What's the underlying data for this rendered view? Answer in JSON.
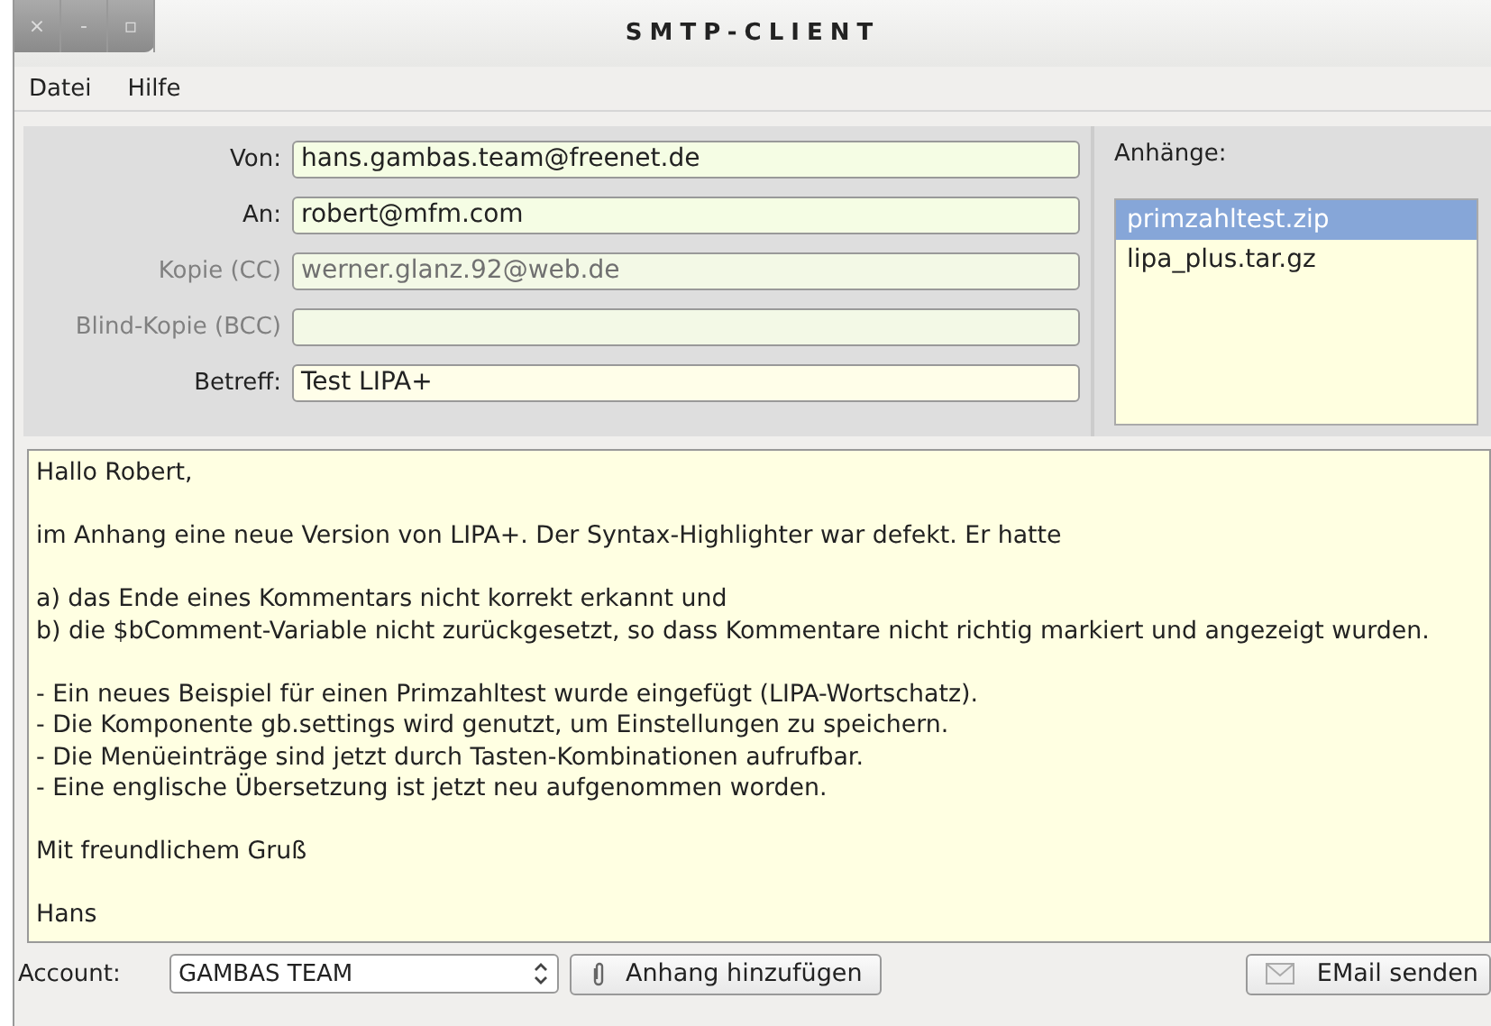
{
  "window": {
    "title": "SMTP-CLIENT",
    "controls": [
      "×",
      "-",
      "▫"
    ]
  },
  "menu": [
    "Datei",
    "Hilfe"
  ],
  "fields": [
    {
      "label": "Von:",
      "value": "hans.gambas.team@freenet.de",
      "disabled": false
    },
    {
      "label": "An:",
      "value": "robert@mfm.com",
      "disabled": false
    },
    {
      "label": "Kopie (CC)",
      "value": "werner.glanz.92@web.de",
      "disabled": true
    },
    {
      "label": "Blind-Kopie (BCC)",
      "disabled": true
    },
    {
      "label": "Betreff:",
      "value": "Test LIPA+",
      "disabled": false
    }
  ],
  "attachments": {
    "label": "Anhänge:",
    "items": [
      {
        "name": "primzahltest.zip",
        "selected": true
      },
      {
        "name": "lipa_plus.tar.gz",
        "selected": false
      }
    ]
  },
  "body": [
    [
      "Hallo Robert,"
    ],
    [
      "im Anhang eine neue Version von LIPA+. Der Syntax-Highlighter war defekt. Er hatte"
    ],
    [
      "a) das Ende eines Kommentars nicht korrekt erkannt und",
      "b) die $bComment-Variable nicht zurückgesetzt, so dass Kommentare nicht richtig markiert und angezeigt wurden."
    ],
    [
      "- Ein neues Beispiel für einen Primzahltest wurde eingefügt (LIPA-Wortschatz).",
      "- Die Komponente gb.settings wird genutzt, um Einstellungen zu speichern.",
      "- Die Menüeinträge sind jetzt durch Tasten-Kombinationen aufrufbar.",
      "- Eine englische Übersetzung ist jetzt neu aufgenommen worden."
    ],
    [
      "Mit freundlichem Gruß"
    ],
    [
      "Hans"
    ]
  ],
  "footer": {
    "account_label": "Account:",
    "account": "GAMBAS TEAM",
    "attach_button": "Anhang hinzufügen",
    "send_button": "EMail senden"
  }
}
